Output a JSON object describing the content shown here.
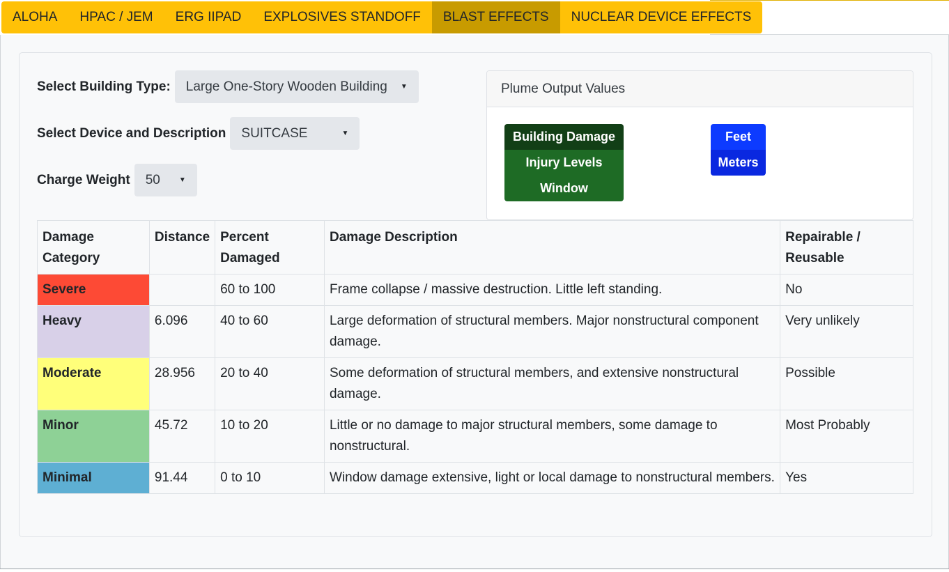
{
  "tabs": [
    {
      "label": "ALOHA",
      "active": false
    },
    {
      "label": "HPAC / JEM",
      "active": false
    },
    {
      "label": "ERG IIPAD",
      "active": false
    },
    {
      "label": "EXPLOSIVES STANDOFF",
      "active": false
    },
    {
      "label": "BLAST EFFECTS",
      "active": true
    },
    {
      "label": "NUCLEAR DEVICE EFFECTS",
      "active": false
    }
  ],
  "form": {
    "building_type_label": "Select Building Type:",
    "building_type_value": "Large One-Story Wooden Building",
    "device_label": "Select Device and Description",
    "device_value": "SUITCASE",
    "charge_weight_label": "Charge Weight",
    "charge_weight_value": "50"
  },
  "plume": {
    "title": "Plume Output Values",
    "output_buttons": [
      {
        "label": "Building Damage",
        "active": true
      },
      {
        "label": "Injury Levels",
        "active": false
      },
      {
        "label": "Window Breakage",
        "active": false
      }
    ],
    "unit_buttons": [
      {
        "label": "Feet",
        "active": true
      },
      {
        "label": "Meters",
        "active": false
      }
    ]
  },
  "table": {
    "headers": [
      "Damage Category",
      "Distance",
      "Percent Damaged",
      "Damage Description",
      "Repairable / Reusable"
    ],
    "rows": [
      {
        "category": "Severe",
        "color": "#fd4a35",
        "distance": "",
        "percent": "60 to 100",
        "description": "Frame collapse / massive destruction. Little left standing.",
        "repairable": "No"
      },
      {
        "category": "Heavy",
        "color": "#d8d0e8",
        "distance": "6.096",
        "percent": "40 to 60",
        "description": "Large deformation of structural members. Major nonstructural component damage.",
        "repairable": "Very unlikely"
      },
      {
        "category": "Moderate",
        "color": "#ffff7a",
        "distance": "28.956",
        "percent": "20 to 40",
        "description": "Some deformation of structural members, and extensive nonstructural damage.",
        "repairable": "Possible"
      },
      {
        "category": "Minor",
        "color": "#8ed196",
        "distance": "45.72",
        "percent": "10 to 20",
        "description": "Little or no damage to major structural members, some damage to nonstructural.",
        "repairable": "Most Probably"
      },
      {
        "category": "Minimal",
        "color": "#5eafd3",
        "distance": "91.44",
        "percent": "0 to 10",
        "description": "Window damage extensive, light or local damage to nonstructural members.",
        "repairable": "Yes"
      }
    ]
  }
}
